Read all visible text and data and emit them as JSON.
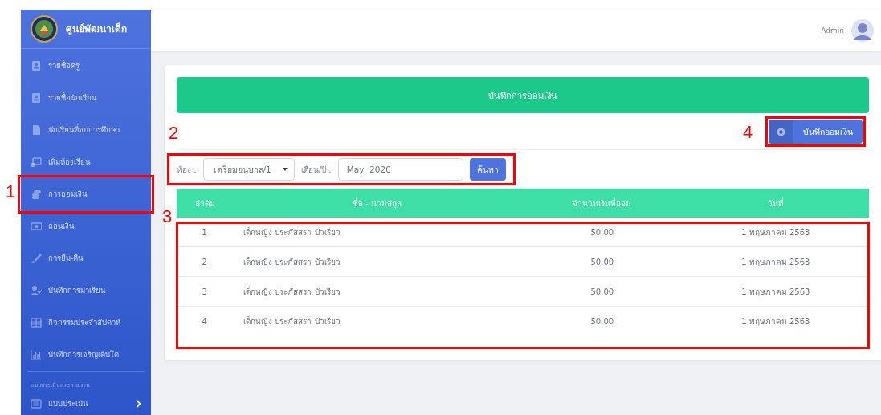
{
  "brand": {
    "title": "ศูนย์พัฒนาเด็ก"
  },
  "sidebar": {
    "items": [
      {
        "label": "รายชื่อครู"
      },
      {
        "label": "รายชื่อนักเรียน"
      },
      {
        "label": "นักเรียนที่จบการศึกษา"
      },
      {
        "label": "เพิ่มห้องเรียน"
      },
      {
        "label": "การออมเงิน",
        "callout": "1"
      },
      {
        "label": "ถอนเงิน"
      },
      {
        "label": "การยืม-คืน"
      },
      {
        "label": "บันทึกการมาเรียน"
      },
      {
        "label": "กิจกรรมประจำสัปดาห์"
      },
      {
        "label": "บันทึกการเจริญเติบโต"
      }
    ],
    "section": "แบบประเมินและรายงาน",
    "submenu": {
      "label": "แบบประเมิน"
    }
  },
  "topbar": {
    "user": "Admin"
  },
  "card": {
    "banner": "บันทึกการออมเงิน",
    "add_button": {
      "label": "บันทึกออมเงิน",
      "callout": "4"
    },
    "filter": {
      "callout": "2",
      "room_label": "ห้อง :",
      "room_value": "เตรียมอนุบาล/1",
      "month_label": "เดือน/ปี :",
      "month_value": "May  2020",
      "search_button": "ค้นหา"
    },
    "table": {
      "callout": "3",
      "columns": [
        "ลำดับ",
        "ชื่อ - นามสกุล",
        "จำนวนเงินที่ออม",
        "วันที่"
      ],
      "rows": [
        [
          "1",
          "เด็กหญิง ประภัสสรา บัวเรียว",
          "50.00",
          "1 พฤษภาคม 2563"
        ],
        [
          "2",
          "เด็กหญิง ประภัสสรา บัวเรียว",
          "50.00",
          "1 พฤษภาคม 2563"
        ],
        [
          "3",
          "เด็กหญิง ประภัสสรา บัวเรียว",
          "50.00",
          "1 พฤษภาคม 2563"
        ],
        [
          "4",
          "เด็กหญิง ประภัสสรา บัวเรียว",
          "50.00",
          "1 พฤษภาคม 2563"
        ]
      ]
    }
  }
}
